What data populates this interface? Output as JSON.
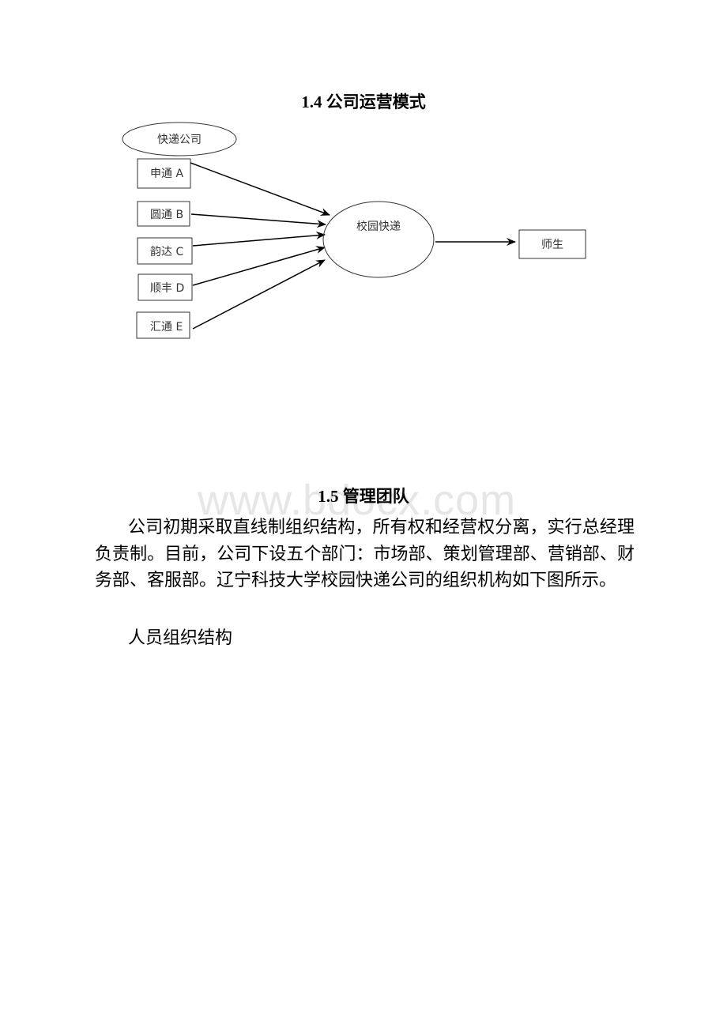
{
  "section_1_4": {
    "title": "1.4 公司运营模式"
  },
  "diagram": {
    "source_label": "快递公司",
    "companies": [
      "申通 A",
      "圆通 B",
      "韵达 C",
      "顺丰 D",
      "汇通 E"
    ],
    "hub": "校园快递",
    "target": "师生"
  },
  "watermark": "www.bdocx.com",
  "section_1_5": {
    "title": "1.5 管理团队",
    "paragraph": "公司初期采取直线制组织结构，所有权和经营权分离，实行总经理负责制。目前，公司下设五个部门：市场部、策划管理部、营销部、财务部、客服部。辽宁科技大学校园快递公司的组织机构如下图所示。",
    "subheading": "人员组织结构"
  }
}
